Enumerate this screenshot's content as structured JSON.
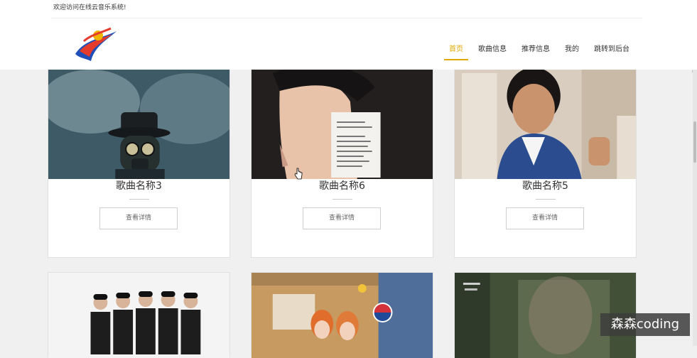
{
  "header": {
    "welcome": "欢迎访问在线云音乐系统!",
    "nav": [
      {
        "label": "首页",
        "active": true
      },
      {
        "label": "歌曲信息",
        "active": false
      },
      {
        "label": "推荐信息",
        "active": false
      },
      {
        "label": "我的",
        "active": false
      },
      {
        "label": "跳转到后台",
        "active": false
      }
    ],
    "accent_color": "#e0a800"
  },
  "cards": [
    {
      "title": "歌曲名称3",
      "button": "查看详情"
    },
    {
      "title": "歌曲名称6",
      "button": "查看详情"
    },
    {
      "title": "歌曲名称5",
      "button": "查看详情"
    },
    {
      "title": "",
      "button": ""
    },
    {
      "title": "",
      "button": ""
    },
    {
      "title": "",
      "button": ""
    }
  ],
  "watermark": "森森coding"
}
